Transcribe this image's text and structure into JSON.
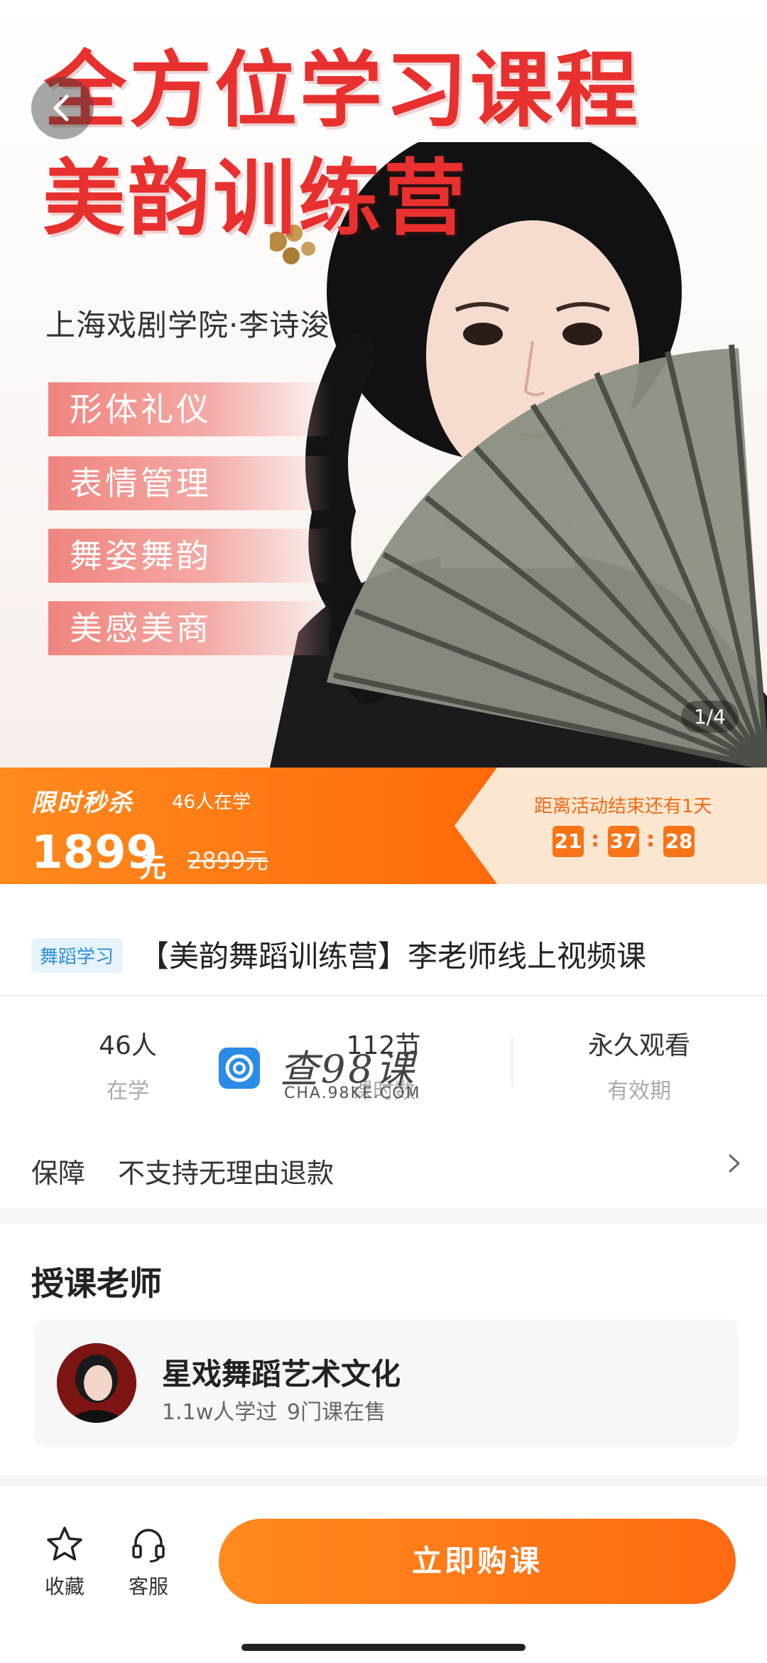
{
  "hero": {
    "title_line1": "全方位学习课程",
    "title_line2": "美韵训练营",
    "subtitle": "上海戏剧学院·李诗浚",
    "tags": [
      "形体礼仪",
      "表情管理",
      "舞姿舞韵",
      "美感美商"
    ],
    "image_counter": "1/4",
    "accent_color": "#e8302e"
  },
  "promo": {
    "flash_label": "限时秒杀",
    "learners": "46人在学",
    "price": "1899",
    "price_unit": "元",
    "original_price": "2899元",
    "countdown_label": "距离活动结束还有1天",
    "countdown": {
      "h": "21",
      "m": "37",
      "s": "28"
    },
    "accent_color": "#ff7a14"
  },
  "course": {
    "category": "舞蹈学习",
    "title": "【美韵舞蹈训练营】李老师线上视频课"
  },
  "stats": [
    {
      "value": "46人",
      "label": "在学"
    },
    {
      "value": "112节",
      "label": "课时数"
    },
    {
      "value": "永久观看",
      "label": "有效期"
    }
  ],
  "watermark": {
    "text": "查98课",
    "domain": "CHA.98KE.COM"
  },
  "guarantee": {
    "label": "保障",
    "text": "不支持无理由退款"
  },
  "teacher": {
    "heading": "授课老师",
    "name": "星戏舞蹈艺术文化",
    "learned": "1.1w人学过",
    "courses": "9门课在售"
  },
  "bottom_bar": {
    "favorite": "收藏",
    "service": "客服",
    "buy": "立即购课"
  }
}
